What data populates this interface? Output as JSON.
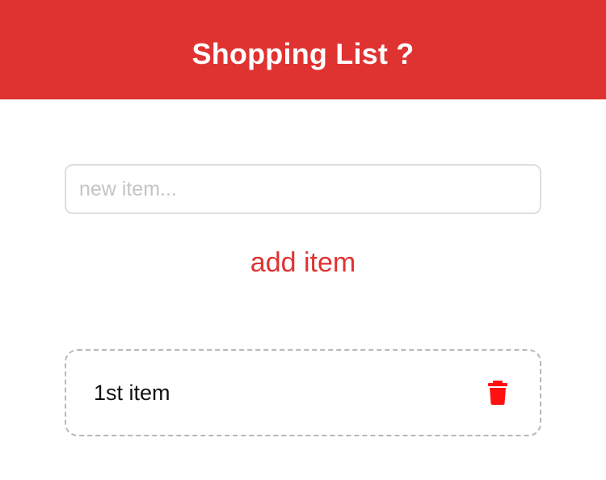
{
  "header": {
    "title": "Shopping List ?"
  },
  "form": {
    "input_value": "",
    "input_placeholder": "new item...",
    "add_label": "add item"
  },
  "items": [
    {
      "label": "1st item",
      "delete_icon": "trash-icon"
    }
  ],
  "colors": {
    "accent": "#df3331",
    "delete_icon": "#ff1111",
    "input_border": "#dedede",
    "item_border": "#b8b8b8"
  }
}
